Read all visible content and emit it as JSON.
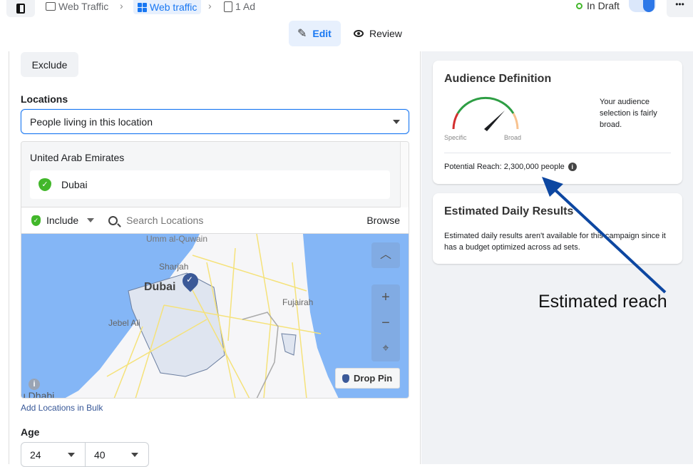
{
  "header": {
    "breadcrumbs": [
      "Web Traffic",
      "Web traffic",
      "1 Ad"
    ],
    "status": "In Draft",
    "status_color": "#42b72a",
    "toggle_on": true,
    "more_icon": "ellipsis-icon"
  },
  "tabs": [
    {
      "label": "Edit",
      "icon": "pencil-icon",
      "active": true
    },
    {
      "label": "Review",
      "icon": "eye-icon",
      "active": false
    }
  ],
  "audience": {
    "exclude_label": "Exclude",
    "locations_label": "Locations",
    "location_type": "People living in this location",
    "country": "United Arab Emirates",
    "selected_location": "Dubai",
    "include_label": "Include",
    "search_placeholder": "Search Locations",
    "browse_label": "Browse",
    "map_labels": [
      "Umm al-Quwain",
      "Sharjah",
      "Dubai",
      "Jebel Ali",
      "Fujairah",
      "u Dhabi"
    ],
    "drop_pin_label": "Drop Pin",
    "bulk_link": "Add Locations in Bulk",
    "age_label": "Age",
    "age_min": "24",
    "age_max": "40"
  },
  "audience_definition": {
    "title": "Audience Definition",
    "gauge_left": "Specific",
    "gauge_right": "Broad",
    "description": "Your audience selection is fairly broad.",
    "potential_reach": "Potential Reach: 2,300,000 people"
  },
  "daily_results": {
    "title": "Estimated Daily Results",
    "text": "Estimated daily results aren't available for this campaign since it has a budget optimized across ad sets."
  },
  "annotation": {
    "text": "Estimated reach",
    "color": "#0d47a1"
  }
}
